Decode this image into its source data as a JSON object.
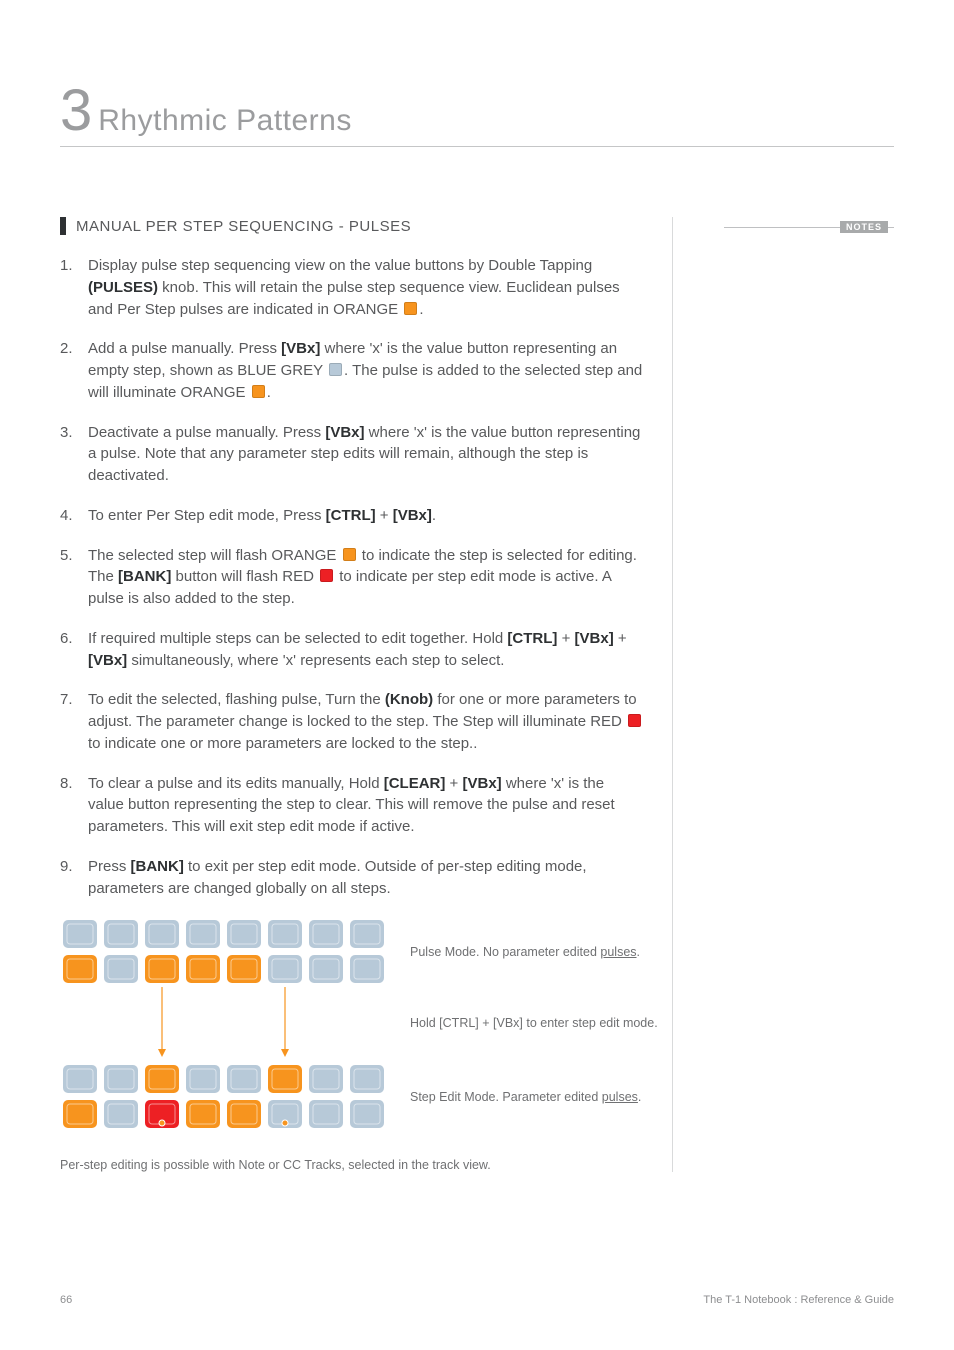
{
  "chapter": {
    "number": "3",
    "title": "Rhythmic Patterns"
  },
  "notes_label": "NOTES",
  "subheading": "MANUAL PER STEP SEQUENCING - PULSES",
  "steps": {
    "s1a": "Display pulse step sequencing view on the value buttons by Double Tapping ",
    "s1b": "(PULSES)",
    "s1c": " knob. This will retain the pulse step sequence view. Euclidean pulses and Per Step pulses are indicated in ORANGE ",
    "s1d": ".",
    "s2a": "Add a pulse manually. Press ",
    "s2b": "[VBx]",
    "s2c": " where 'x' is the value button representing an empty step, shown as BLUE GREY ",
    "s2d": ". The pulse is added to the selected step and will illuminate ORANGE ",
    "s2e": ".",
    "s3a": "Deactivate a pulse manually. Press ",
    "s3b": "[VBx]",
    "s3c": " where 'x' is the value button representing a pulse. Note that any parameter step edits will remain, although the step is deactivated.",
    "s4a": "To enter Per Step edit mode, Press ",
    "s4b": "[CTRL]",
    "s4c": " + ",
    "s4d": "[VBx]",
    "s4e": ".",
    "s5a": "The selected step will flash ORANGE ",
    "s5b": " to indicate the step is selected for editing. The ",
    "s5c": "[BANK]",
    "s5d": " button will flash RED ",
    "s5e": " to indicate per step edit mode is active. A pulse is also added to the step.",
    "s6a": "If required multiple steps can be selected to edit together. Hold ",
    "s6b": "[CTRL]",
    "s6c": " + ",
    "s6d": "[VBx]",
    "s6e": " + ",
    "s6f": "[VBx]",
    "s6g": " simultaneously, where 'x' represents each step to select.",
    "s7a": "To edit the selected, flashing pulse, Turn the ",
    "s7b": "(Knob)",
    "s7c": " for one or more parameters to adjust. The parameter change is locked to the step. The Step will illuminate RED ",
    "s7d": " to indicate one or more parameters are locked to the step..",
    "s8a": "To clear a pulse and its edits manually, Hold ",
    "s8b": "[CLEAR]",
    "s8c": " + ",
    "s8d": "[VBx]",
    "s8e": " where 'x' is the value button representing the step to clear. This will remove the pulse and reset parameters. This will exit step edit mode if active.",
    "s9a": "Press ",
    "s9b": "[BANK]",
    "s9c": " to exit per step edit mode. Outside of per-step editing mode, parameters are changed globally on all steps."
  },
  "diagram": {
    "top_row1": [
      "bg",
      "bg",
      "bg",
      "bg",
      "bg",
      "bg",
      "bg",
      "bg"
    ],
    "top_row2": [
      "or",
      "bg",
      "or",
      "or",
      "or",
      "bg",
      "bg",
      "bg"
    ],
    "bot_row1": [
      "bg",
      "bg",
      "or",
      "bg",
      "bg",
      "or",
      "bg",
      "bg"
    ],
    "bot_row2": [
      "or",
      "bg",
      "rd",
      "or",
      "or",
      "bg",
      "bg",
      "bg"
    ],
    "label_top_a": "Pulse Mode. No parameter edited ",
    "label_top_b": "pulses",
    "label_top_c": ".",
    "label_mid": "Hold [CTRL] + [VBx] to enter step edit mode.",
    "label_bot_a": "Step Edit Mode. Parameter edited ",
    "label_bot_b": "pulses",
    "label_bot_c": ".",
    "footnote": "Per-step editing is possible with Note or CC Tracks, selected in the track view."
  },
  "footer": {
    "page": "66",
    "doc": "The T-1 Notebook : Reference & Guide"
  },
  "colors": {
    "orange": "#f7941e",
    "bluegrey": "#b7c9d8",
    "red": "#ed2024"
  }
}
